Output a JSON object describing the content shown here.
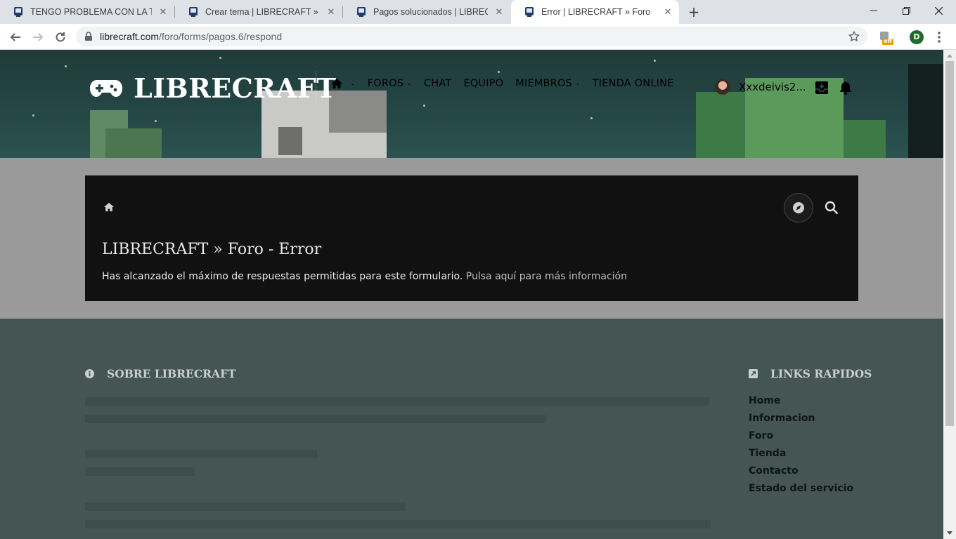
{
  "browser": {
    "tabs": [
      {
        "title": "TENGO PROBLEMA CON LA TIENDA",
        "active": false
      },
      {
        "title": "Crear tema | LIBRECRAFT » Foro",
        "active": false
      },
      {
        "title": "Pagos solucionados | LIBRECRAFT",
        "active": false
      },
      {
        "title": "Error | LIBRECRAFT » Foro",
        "active": true
      }
    ],
    "url_host": "librecraft.com",
    "url_path": "/foro/forms/pagos.6/respond",
    "profile_initial": "D",
    "extension_badge": "off"
  },
  "site": {
    "logo_text": "LIBRECRAFT",
    "nav": [
      {
        "label": "FOROS",
        "dropdown": true
      },
      {
        "label": "CHAT",
        "dropdown": false
      },
      {
        "label": "EQUIPO",
        "dropdown": false
      },
      {
        "label": "MIEMBROS",
        "dropdown": true
      },
      {
        "label": "TIENDA ONLINE",
        "dropdown": false
      }
    ],
    "username": "Xxxdeivis2..."
  },
  "error": {
    "title": "LIBRECRAFT » Foro - Error",
    "message": "Has alcanzado el máximo de respuestas permitidas para este formulario.",
    "link": "Pulsa aquí para más información"
  },
  "footer": {
    "about_heading": "SOBRE LIBRECRAFT",
    "links_heading": "LINKS RAPIDOS",
    "links": [
      "Home",
      "Informacion",
      "Foro",
      "Tienda",
      "Contacto",
      "Estado del servicio"
    ]
  },
  "colors": {
    "hero": "#244745",
    "card": "#111111",
    "footer": "#445554",
    "overlay_gray": "#9a9a9a"
  }
}
